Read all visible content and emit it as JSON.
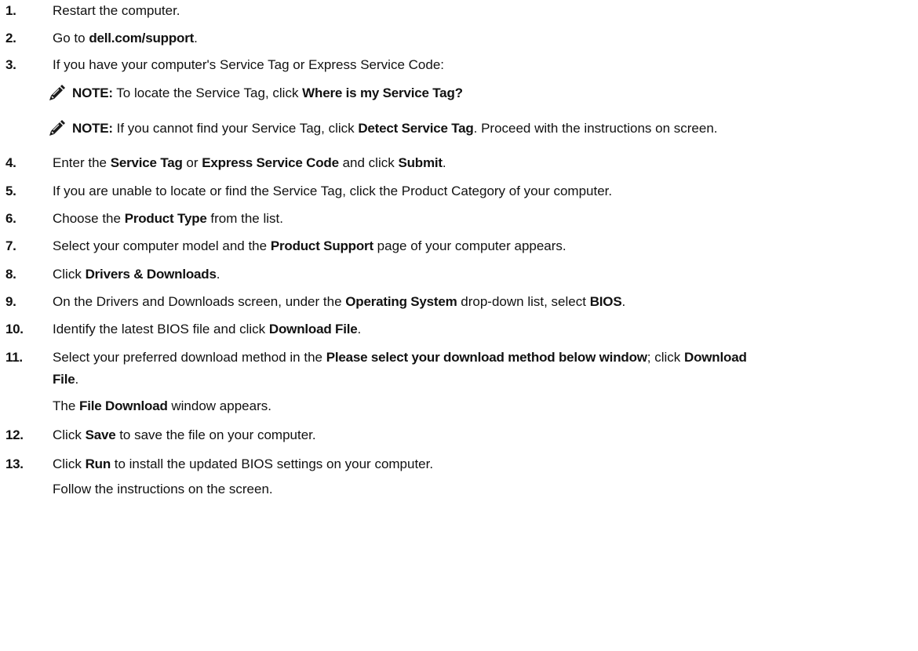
{
  "steps": [
    {
      "num": "1.",
      "parts": [
        {
          "t": "Restart the computer."
        }
      ]
    },
    {
      "num": "2.",
      "parts": [
        {
          "t": "Go to "
        },
        {
          "b": "dell.com/support"
        },
        {
          "t": "."
        }
      ]
    },
    {
      "num": "3.",
      "parts": [
        {
          "t": "If you have your computer's Service Tag or Express Service Code:"
        }
      ]
    },
    {
      "num": "4.",
      "parts": [
        {
          "t": "Enter the "
        },
        {
          "b": "Service Tag"
        },
        {
          "t": " or "
        },
        {
          "b": "Express Service Code"
        },
        {
          "t": " and click "
        },
        {
          "b": "Submit"
        },
        {
          "t": "."
        }
      ]
    },
    {
      "num": "5.",
      "parts": [
        {
          "t": "If you are unable to locate or find the Service Tag, click the Product Category of your computer."
        }
      ]
    },
    {
      "num": "6.",
      "parts": [
        {
          "t": "Choose the "
        },
        {
          "b": "Product Type"
        },
        {
          "t": " from the list."
        }
      ]
    },
    {
      "num": "7.",
      "parts": [
        {
          "t": "Select your computer model and the "
        },
        {
          "b": "Product Support"
        },
        {
          "t": " page of your computer appears."
        }
      ]
    },
    {
      "num": "8.",
      "parts": [
        {
          "t": "Click "
        },
        {
          "b": "Drivers & Downloads"
        },
        {
          "t": "."
        }
      ]
    },
    {
      "num": "9.",
      "parts": [
        {
          "t": "On the Drivers and Downloads screen, under the "
        },
        {
          "b": "Operating System"
        },
        {
          "t": " drop-down list, select "
        },
        {
          "b": "BIOS"
        },
        {
          "t": "."
        }
      ]
    },
    {
      "num": "10.",
      "parts": [
        {
          "t": "Identify the latest BIOS file and click "
        },
        {
          "b": "Download File"
        },
        {
          "t": "."
        }
      ]
    },
    {
      "num": "11.",
      "lines": [
        [
          {
            "t": "Select your preferred download method in the "
          },
          {
            "b": "Please select your download method below window"
          },
          {
            "t": "; click "
          },
          {
            "b": "Download"
          }
        ],
        [
          {
            "b": "File"
          },
          {
            "t": "."
          }
        ],
        [
          {
            "t": "The "
          },
          {
            "b": "File Download"
          },
          {
            "t": " window appears."
          }
        ]
      ]
    },
    {
      "num": "12.",
      "parts": [
        {
          "t": "Click "
        },
        {
          "b": "Save"
        },
        {
          "t": " to save the file on your computer."
        }
      ]
    },
    {
      "num": "13.",
      "lines": [
        [
          {
            "t": "Click "
          },
          {
            "b": "Run"
          },
          {
            "t": " to install the updated BIOS settings on your computer."
          }
        ],
        [
          {
            "t": "Follow the instructions on the screen."
          }
        ]
      ]
    }
  ],
  "notes": [
    {
      "label": "NOTE:",
      "parts": [
        {
          "t": " To locate the Service Tag, click "
        },
        {
          "b": "Where is my Service Tag?"
        }
      ]
    },
    {
      "label": "NOTE:",
      "parts": [
        {
          "t": " If you cannot find your Service Tag, click "
        },
        {
          "b": "Detect Service Tag"
        },
        {
          "t": ". Proceed with the instructions on screen."
        }
      ]
    }
  ],
  "icons": {
    "note": "note-pencil-icon"
  }
}
